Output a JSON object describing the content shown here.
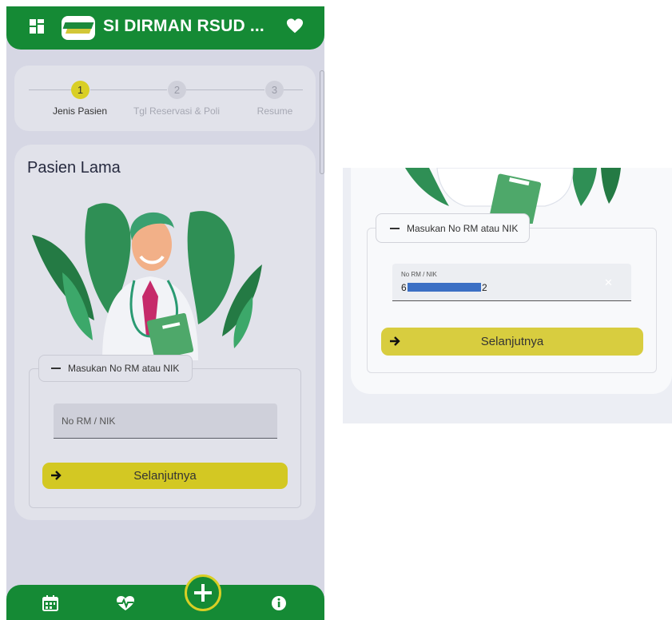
{
  "app": {
    "title": "SI DIRMAN RSUD ...",
    "icons": {
      "menu": "dashboard-grid-icon",
      "favorite": "heart-icon",
      "logo": "hospital-logo"
    }
  },
  "stepper": {
    "steps": [
      {
        "number": "1",
        "label": "Jenis Pasien",
        "active": true
      },
      {
        "number": "2",
        "label": "Tgl Reservasi & Poli",
        "active": false
      },
      {
        "number": "3",
        "label": "Resume",
        "active": false
      }
    ]
  },
  "main": {
    "title": "Pasien Lama",
    "illustration": "doctor-illustration",
    "form": {
      "legend": "Masukan No RM atau NIK",
      "input_placeholder": "No RM / NIK",
      "next_label": "Selanjutnya"
    }
  },
  "bottom_nav": {
    "items": [
      {
        "icon": "calendar-icon"
      },
      {
        "icon": "heartbeat-icon"
      },
      {
        "icon": "plus-icon"
      },
      {
        "icon": "info-icon"
      }
    ]
  },
  "zoomed": {
    "form": {
      "legend": "Masukan No RM atau NIK",
      "input_label": "No RM / NIK",
      "input_value_start": "6",
      "input_value_end": "2",
      "next_label": "Selanjutnya"
    }
  },
  "colors": {
    "brand_green": "#158a35",
    "accent_yellow": "#d3c823",
    "page_bg": "#d6d7e4",
    "card_bg": "#e1e2ea"
  }
}
